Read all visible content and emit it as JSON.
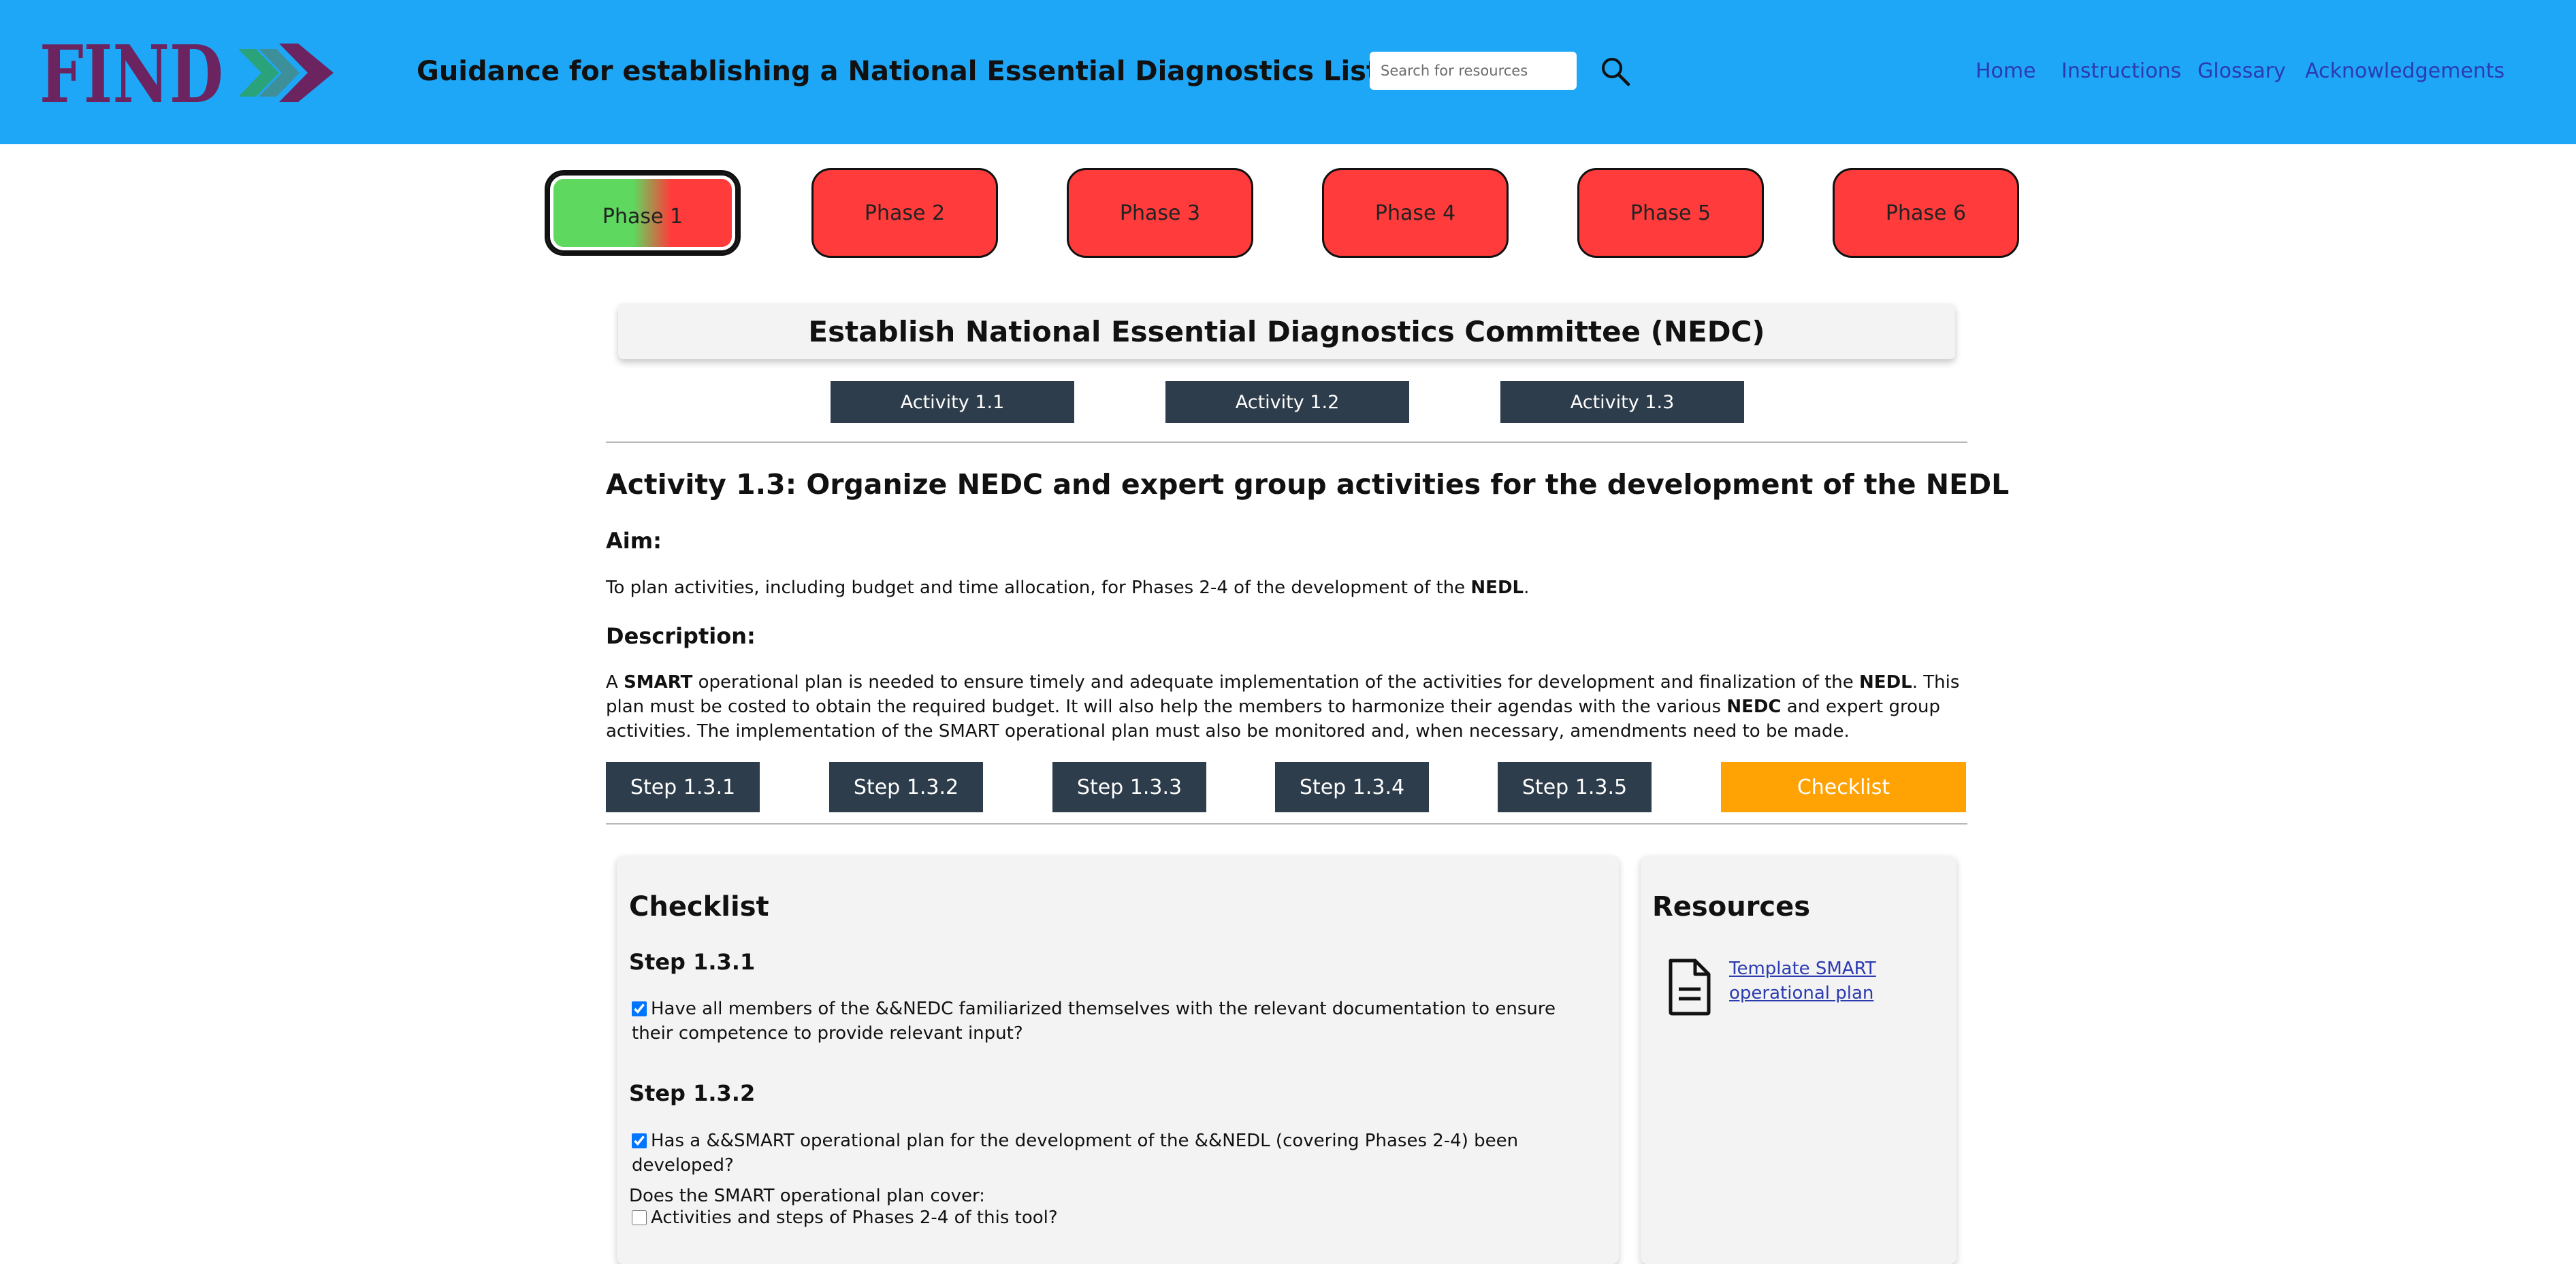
{
  "header": {
    "logo_text": "FIND",
    "title": "Guidance for establishing a National Essential Diagnostics List",
    "search_placeholder": "Search for resources",
    "nav": [
      "Home",
      "Instructions",
      "Glossary",
      "Acknowledgements"
    ]
  },
  "phases": [
    "Phase 1",
    "Phase 2",
    "Phase 3",
    "Phase 4",
    "Phase 5",
    "Phase 6"
  ],
  "section_title": "Establish National Essential Diagnostics Committee (NEDC)",
  "activities": [
    "Activity 1.1",
    "Activity 1.2",
    "Activity 1.3"
  ],
  "activity": {
    "heading": "Activity 1.3: Organize NEDC and expert group activities for the development of the NEDL",
    "aim_label": "Aim:",
    "aim_text": {
      "pre": "To plan activities, including budget and time allocation, for Phases 2-4 of the development of the ",
      "bold": "NEDL",
      "post": "."
    },
    "description_label": "Description:",
    "description": {
      "p1": "A ",
      "b1": "SMART",
      "p2": " operational plan is needed to ensure timely and adequate implementation of the activities for development and finalization of the ",
      "b2": "NEDL",
      "p3": ". This plan must be costed to obtain the required budget. It will also help the members to harmonize their agendas with the various ",
      "b3": "NEDC",
      "p4": " and expert group activities. The implementation of the SMART operational plan must also be monitored and, when necessary, amendments need to be made."
    }
  },
  "steps": [
    "Step 1.3.1",
    "Step 1.3.2",
    "Step 1.3.3",
    "Step 1.3.4",
    "Step 1.3.5"
  ],
  "checklist_button": "Checklist",
  "checklist": {
    "title": "Checklist",
    "step1_label": "Step 1.3.1",
    "step1_item": "Have all members of the &&NEDC familiarized themselves with the relevant documentation to ensure their competence to provide relevant input?",
    "step2_label": "Step 1.3.2",
    "step2_item": "Has a &&SMART operational plan for the development of the &&NEDL (covering Phases 2-4) been developed?",
    "question": "Does the SMART operational plan cover:",
    "sub_item": "Activities and steps of Phases 2-4 of this tool?"
  },
  "resources": {
    "title": "Resources",
    "link": "Template SMART operational plan"
  },
  "colors": {
    "header_bg": "#1ea7f7",
    "phase_inactive": "#ff3b3b",
    "phase_active": "#5fd85f",
    "dark_button": "#2e3d4b",
    "checklist_button": "#ffa203",
    "logo_purple": "#6b2460",
    "logo_green": "#2aa37a"
  }
}
